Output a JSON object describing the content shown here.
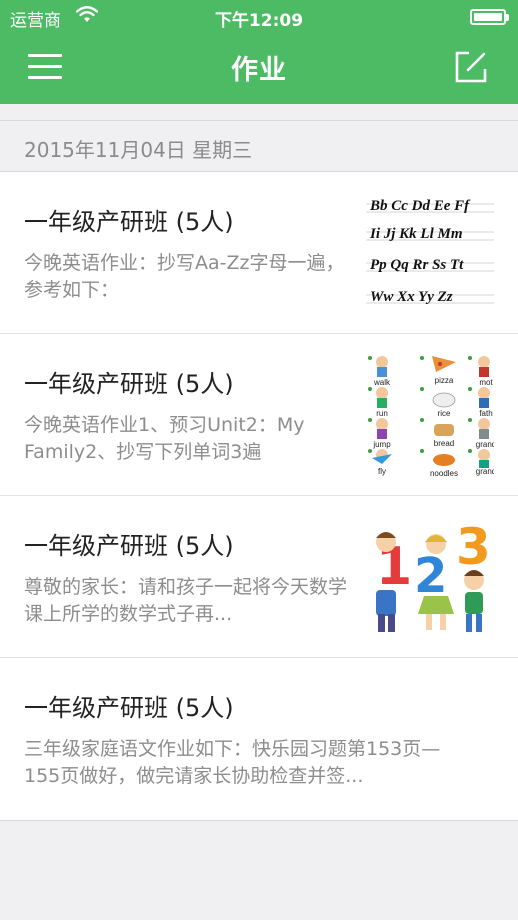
{
  "status_bar": {
    "carrier": "运营商",
    "time": "下午12:09"
  },
  "nav": {
    "title": "作业"
  },
  "date_header": "2015年11月04日 星期三",
  "items": [
    {
      "title": "一年级产研班 (5人)",
      "desc": "今晚英语作业：抄写Aa-Zz字母一遍，参考如下："
    },
    {
      "title": "一年级产研班 (5人)",
      "desc": "今晚英语作业1、预习Unit2：My Family2、抄写下列单词3遍"
    },
    {
      "title": "一年级产研班 (5人)",
      "desc": "尊敬的家长：请和孩子一起将今天数学课上所学的数学式子再..."
    },
    {
      "title": "一年级产研班 (5人)",
      "desc": "三年级家庭语文作业如下：快乐园习题第153页—155页做好，做完请家长协助检查并签..."
    }
  ],
  "thumbs": {
    "alphabet": {
      "row1": "Bb Cc Dd Ee Ff",
      "row2": "Ii Jj Kk Ll Mm",
      "row3": "Pp Qq Rr Ss Tt",
      "row4": "Ww Xx Yy Zz"
    },
    "vocab": {
      "walk": "walk",
      "pizza": "pizza",
      "mot": "mot",
      "run": "run",
      "rice": "rice",
      "fath": "fath",
      "jump": "jump",
      "bread": "bread",
      "grand1": "grand",
      "fly": "fly",
      "noodles": "noodles",
      "grand2": "grand"
    },
    "numbers": {
      "n1": "1",
      "n2": "2",
      "n3": "3"
    }
  },
  "colors": {
    "accent": "#4cbb64",
    "background": "#f0f0f2"
  }
}
